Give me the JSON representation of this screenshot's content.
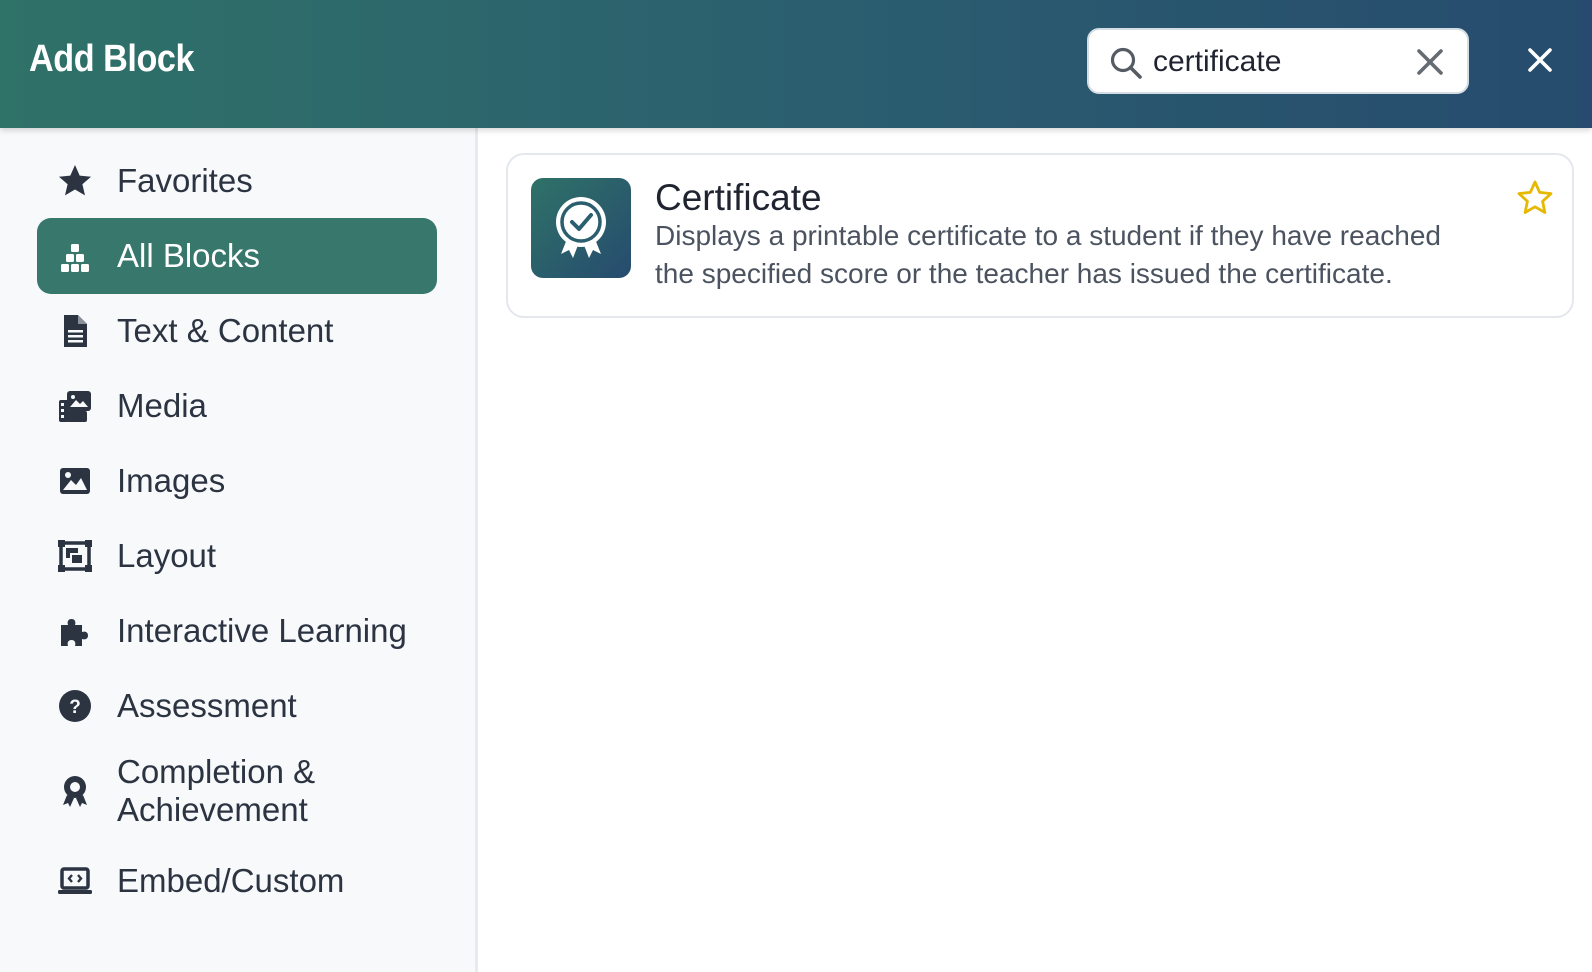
{
  "header": {
    "title": "Add Block",
    "search": {
      "value": "certificate",
      "placeholder": ""
    }
  },
  "sidebar": {
    "items": [
      {
        "label": "Favorites",
        "icon": "star-icon",
        "active": false
      },
      {
        "label": "All Blocks",
        "icon": "blocks-icon",
        "active": true
      },
      {
        "label": "Text & Content",
        "icon": "document-icon",
        "active": false
      },
      {
        "label": "Media",
        "icon": "media-icon",
        "active": false
      },
      {
        "label": "Images",
        "icon": "image-icon",
        "active": false
      },
      {
        "label": "Layout",
        "icon": "layout-icon",
        "active": false
      },
      {
        "label": "Interactive Learning",
        "icon": "puzzle-icon",
        "active": false
      },
      {
        "label": "Assessment",
        "icon": "question-icon",
        "active": false
      },
      {
        "label": "Completion & Achievement",
        "icon": "award-icon",
        "active": false
      },
      {
        "label": "Embed/Custom",
        "icon": "laptop-code-icon",
        "active": false
      }
    ]
  },
  "results": [
    {
      "title": "Certificate",
      "description": "Displays a printable certificate to a student if they have reached the specified score or the teacher has issued the certificate.",
      "icon": "certificate-badge-icon",
      "favorite": false
    }
  ],
  "colors": {
    "header_start": "#2f7268",
    "header_end": "#264b6e",
    "active_item": "#37776c",
    "favorite_star": "#e6b800"
  }
}
